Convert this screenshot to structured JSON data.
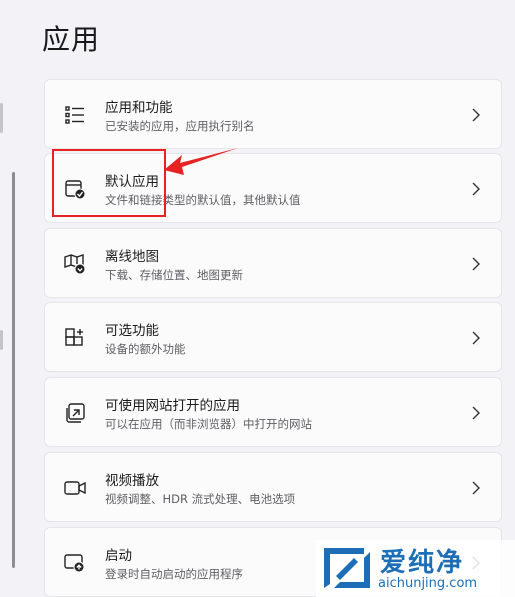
{
  "page": {
    "title": "应用"
  },
  "items": [
    {
      "title": "应用和功能",
      "subtitle": "已安装的应用，应用执行别名",
      "icon": "list-icon"
    },
    {
      "title": "默认应用",
      "subtitle": "文件和链接类型的默认值，其他默认值",
      "icon": "default-apps-icon"
    },
    {
      "title": "离线地图",
      "subtitle": "下载、存储位置、地图更新",
      "icon": "offline-map-icon"
    },
    {
      "title": "可选功能",
      "subtitle": "设备的额外功能",
      "icon": "optional-features-icon"
    },
    {
      "title": "可使用网站打开的应用",
      "subtitle": "可以在应用（而非浏览器）中打开的网站",
      "icon": "open-link-icon"
    },
    {
      "title": "视频播放",
      "subtitle": "视频调整、HDR 流式处理、电池选项",
      "icon": "video-camera-icon"
    },
    {
      "title": "启动",
      "subtitle": "登录时自动启动的应用程序",
      "icon": "startup-icon"
    }
  ],
  "annotation": {
    "color": "#e62222"
  },
  "watermark": {
    "brand": "爱纯净",
    "url": "aichunjing.com",
    "color": "#1c6fb7"
  }
}
